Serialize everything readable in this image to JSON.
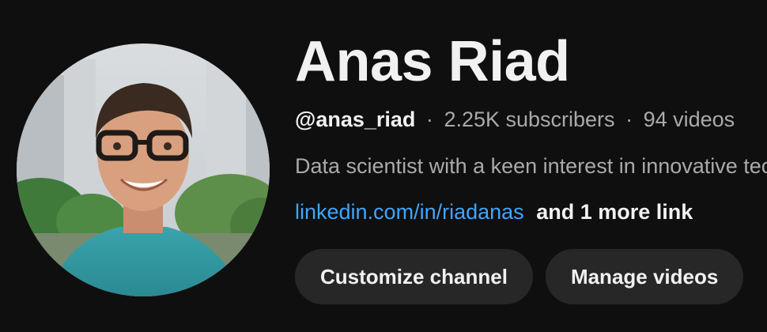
{
  "channel": {
    "name": "Anas Riad",
    "handle": "@anas_riad",
    "separator": "·",
    "subscribers": "2.25K subscribers",
    "videos": "94 videos",
    "description": "Data scientist with a keen interest in innovative tech",
    "link_text": "linkedin.com/in/riadanas",
    "more_links": "and 1 more link"
  },
  "actions": {
    "customize_label": "Customize channel",
    "manage_label": "Manage videos"
  },
  "colors": {
    "background": "#0f0f0f",
    "link": "#3ea6ff",
    "button_bg": "#272727",
    "muted_text": "#aaaaaa"
  }
}
